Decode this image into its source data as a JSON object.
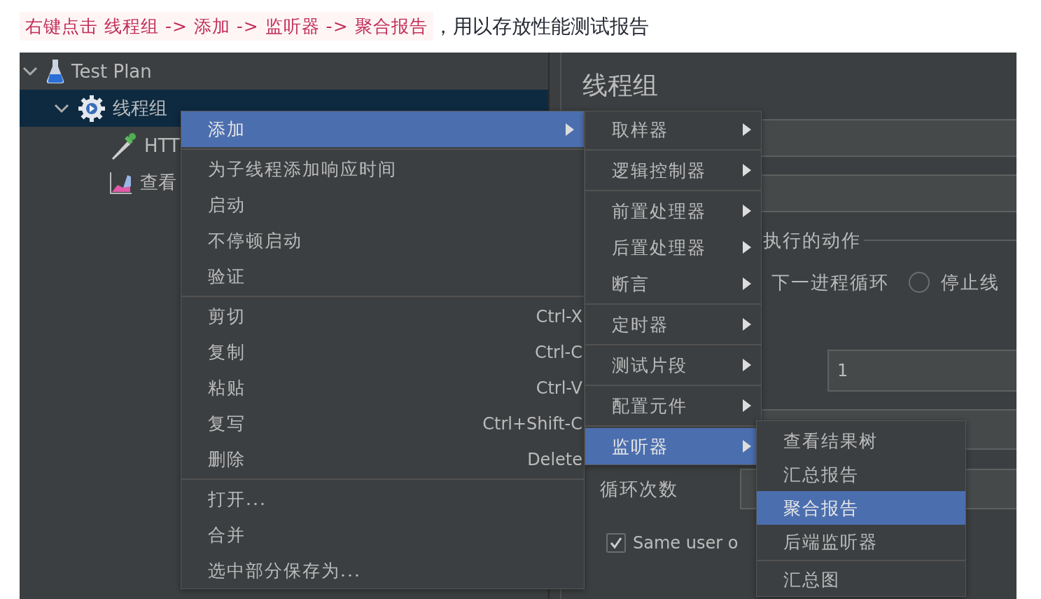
{
  "caption": {
    "code": "右键点击 线程组 -> 添加 -> 监听器 -> 聚合报告",
    "text": "，用以存放性能测试报告"
  },
  "tree": [
    {
      "label": "Test Plan",
      "selected": false,
      "expanded": true,
      "children": [
        {
          "label": "线程组",
          "selected": true,
          "expanded": true,
          "children": [
            {
              "label": "HTT",
              "selected": false
            },
            {
              "label": "查看",
              "selected": false
            }
          ]
        }
      ]
    }
  ],
  "form": {
    "title": "线程组",
    "action_label": "执行的动作",
    "partial_option": "下一进程循环",
    "radio_options": [
      {
        "label": "停止线",
        "selected": false
      }
    ],
    "threads_value": "1",
    "loop_label": "循环次数",
    "same_user": {
      "label": "Same user o",
      "checked": true
    }
  },
  "menu": {
    "groups": [
      [
        {
          "label": "添加",
          "submenu": true,
          "selected": true
        }
      ],
      [
        {
          "label": "为子线程添加响应时间",
          "selected": false
        },
        {
          "label": "启动",
          "selected": false
        },
        {
          "label": "不停顿启动",
          "selected": false
        },
        {
          "label": "验证",
          "selected": false
        }
      ],
      [
        {
          "label": "剪切",
          "shortcut": "Ctrl-X",
          "selected": false
        },
        {
          "label": "复制",
          "shortcut": "Ctrl-C",
          "selected": false
        },
        {
          "label": "粘贴",
          "shortcut": "Ctrl-V",
          "selected": false
        },
        {
          "label": "复写",
          "shortcut": "Ctrl+Shift-C",
          "selected": false
        },
        {
          "label": "删除",
          "shortcut": "Delete",
          "selected": false
        }
      ],
      [
        {
          "label": "打开...",
          "selected": false
        },
        {
          "label": "合并",
          "selected": false
        },
        {
          "label": "选中部分保存为...",
          "selected": false
        }
      ]
    ]
  },
  "add_menu": {
    "groups": [
      [
        {
          "label": "取样器",
          "submenu": true,
          "selected": false
        }
      ],
      [
        {
          "label": "逻辑控制器",
          "submenu": true,
          "selected": false
        }
      ],
      [
        {
          "label": "前置处理器",
          "submenu": true,
          "selected": false
        },
        {
          "label": "后置处理器",
          "submenu": true,
          "selected": false
        },
        {
          "label": "断言",
          "submenu": true,
          "selected": false
        }
      ],
      [
        {
          "label": "定时器",
          "submenu": true,
          "selected": false
        }
      ],
      [
        {
          "label": "测试片段",
          "submenu": true,
          "selected": false
        }
      ],
      [
        {
          "label": "配置元件",
          "submenu": true,
          "selected": false
        }
      ],
      [
        {
          "label": "监听器",
          "submenu": true,
          "selected": true
        }
      ]
    ]
  },
  "listener_menu": {
    "groups": [
      [
        {
          "label": "查看结果树",
          "selected": false
        },
        {
          "label": "汇总报告",
          "selected": false
        },
        {
          "label": "聚合报告",
          "selected": true
        },
        {
          "label": "后端监听器",
          "selected": false
        }
      ],
      [
        {
          "label": "汇总图",
          "selected": false
        }
      ]
    ]
  }
}
